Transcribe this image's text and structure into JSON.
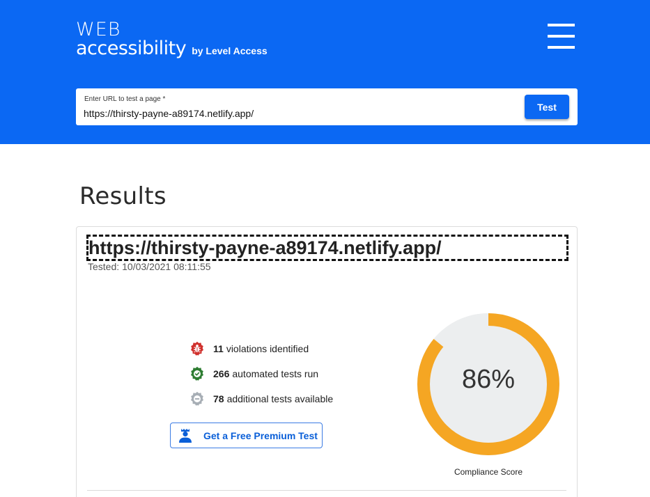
{
  "header": {
    "logo_web": "WEB",
    "logo_accessibility": "accessibility",
    "logo_by": "by Level Access",
    "menu_icon": "hamburger-menu-icon",
    "brand_color": "#0b68f3"
  },
  "search": {
    "label": "Enter URL to test a page *",
    "value": "https://thirsty-payne-a89174.netlify.app/",
    "button_label": "Test"
  },
  "results": {
    "title": "Results",
    "url": "https://thirsty-payne-a89174.netlify.app/",
    "tested_label": "Tested:",
    "tested_date": "10/03/2021 08:11:55",
    "stats": [
      {
        "count": "11",
        "text": "violations identified",
        "icon": "bug-icon",
        "color": "#d0312d"
      },
      {
        "count": "266",
        "text": "automated tests run",
        "icon": "check-badge-icon",
        "color": "#2e7d32"
      },
      {
        "count": "78",
        "text": "additional tests available",
        "icon": "minus-badge-icon",
        "color": "#a7aeb5"
      }
    ],
    "premium_button": "Get a Free Premium Test",
    "score": {
      "value": 0.86,
      "label": "86%",
      "caption": "Compliance Score",
      "color": "#f5a623",
      "track_color": "#eceeef"
    }
  }
}
